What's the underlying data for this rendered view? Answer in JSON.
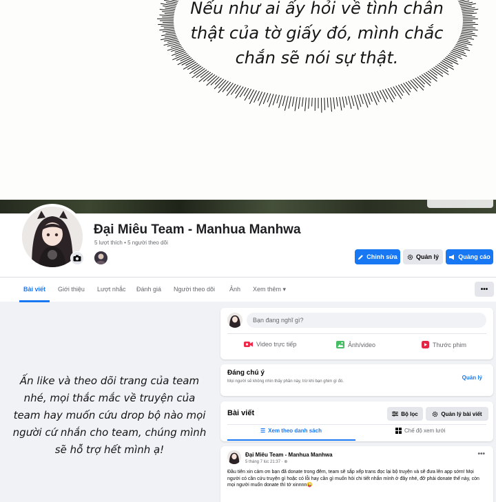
{
  "manga": {
    "speech_lines": [
      "Nếu như ai ấy hỏi về tình chân",
      "thật của tờ giấy đó, mình chắc",
      "chắn sẽ nói sự thật."
    ]
  },
  "page": {
    "name": "Đại Miêu Team - Manhua Manhwa",
    "stats": "5 lượt thích • 5 người theo dõi",
    "buttons": {
      "edit": "Chỉnh sửa",
      "manage": "Quản lý",
      "ads": "Quảng cáo"
    }
  },
  "tabs": {
    "items": [
      "Bài viết",
      "Giới thiệu",
      "Lượt nhắc",
      "Đánh giá",
      "Người theo dõi",
      "Ảnh",
      "Xem thêm"
    ],
    "more_dots": "•••"
  },
  "left_message": {
    "lines": [
      "Ấn like và theo dõi trang của team",
      "nhé, mọi thắc mắc về truyện của",
      "team hay muốn cứu drop bộ nào mọi",
      "người cứ nhắn cho team, chúng mình",
      "sẽ hỗ trợ hết mình ạ!"
    ]
  },
  "composer": {
    "placeholder": "Bạn đang nghĩ gì?",
    "actions": {
      "live": "Video trực tiếp",
      "photo": "Ảnh/video",
      "reel": "Thước phim"
    }
  },
  "notice": {
    "title": "Đáng chú ý",
    "subtitle": "Mọi người sẽ không nhìn thấy phần này, trừ khi bạn ghim gì đó.",
    "manage": "Quản lý"
  },
  "posts_section": {
    "title": "Bài viết",
    "filter": "Bộ lọc",
    "manage": "Quản lý bài viết",
    "list_view": "Xem theo danh sách",
    "grid_view": "Chế độ xem lưới"
  },
  "post": {
    "author": "Đại Miêu Team - Manhua Manhwa",
    "time": "5 tháng 7 lúc 21:37 · ",
    "body": "Đầu tiên xin cảm ơn bạn đã donate trong đêm, team sẽ sắp xếp trans đọc lại bộ truyện và sẽ đưa lên app sớm! Mọi người có cần cứu truyện gì hoặc có lỗi hay cần gì muốn hỏi chi tiết nhắn mình ở đây nhé, đỡ phải donate thế này, còn mọi người muốn donate thì tớ xinnnn😜",
    "more_dots": "•••"
  },
  "colors": {
    "accent": "#1877f2",
    "background": "#f0f2f5",
    "live": "#f02849",
    "photo": "#45bd62",
    "reel": "#e42645"
  },
  "icons": [
    "camera-icon",
    "pencil-icon",
    "gear-icon",
    "megaphone-icon",
    "dropdown-icon",
    "video-icon",
    "photo-icon",
    "reel-icon",
    "filter-icon",
    "list-icon",
    "grid-icon",
    "globe-icon"
  ]
}
